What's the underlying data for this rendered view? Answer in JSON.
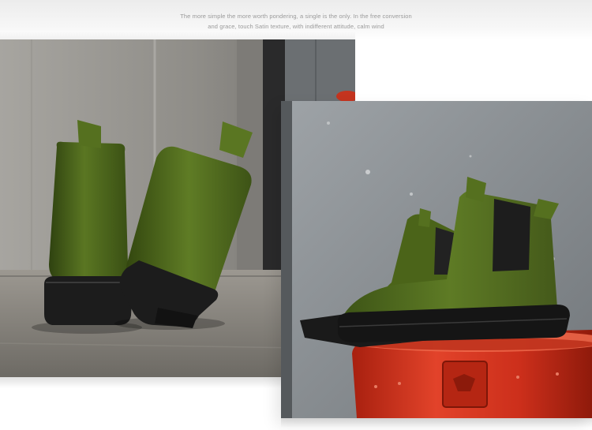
{
  "tagline": {
    "line1": "The more simple the more worth pondering, a single is the only. In the free conversion",
    "line2": "and grace, touch Satin texture, with indifferent attitude, calm wind"
  },
  "colors": {
    "boot_green": "#55701f",
    "boot_green_dark": "#3f5416",
    "sole_black": "#1b1b1b",
    "drum_red": "#d4311f",
    "wall_gray": "#8e8c87"
  },
  "photos": {
    "left": {
      "subject": "boots-rear-view-photo"
    },
    "right": {
      "subject": "boots-on-red-drum-photo"
    }
  }
}
